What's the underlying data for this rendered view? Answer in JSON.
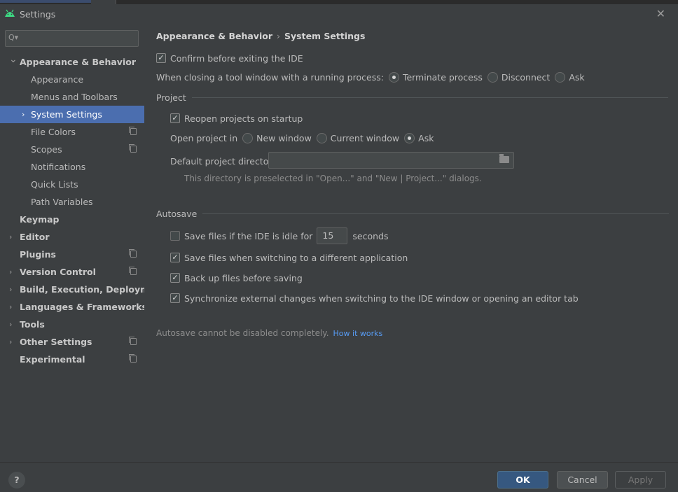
{
  "window": {
    "title": "Settings"
  },
  "search": {
    "placeholder": ""
  },
  "sidebar": {
    "items": [
      {
        "label": "Appearance & Behavior",
        "level": 0,
        "bold": true,
        "arrow": "chevron-down-icon",
        "project": false
      },
      {
        "label": "Appearance",
        "level": 1,
        "bold": false,
        "arrow": "",
        "project": false
      },
      {
        "label": "Menus and Toolbars",
        "level": 1,
        "bold": false,
        "arrow": "",
        "project": false
      },
      {
        "label": "System Settings",
        "level": 1,
        "bold": false,
        "arrow": "chevron-right-icon",
        "project": false,
        "selected": true
      },
      {
        "label": "File Colors",
        "level": 1,
        "bold": false,
        "arrow": "",
        "project": true
      },
      {
        "label": "Scopes",
        "level": 1,
        "bold": false,
        "arrow": "",
        "project": true
      },
      {
        "label": "Notifications",
        "level": 1,
        "bold": false,
        "arrow": "",
        "project": false
      },
      {
        "label": "Quick Lists",
        "level": 1,
        "bold": false,
        "arrow": "",
        "project": false
      },
      {
        "label": "Path Variables",
        "level": 1,
        "bold": false,
        "arrow": "",
        "project": false
      },
      {
        "label": "Keymap",
        "level": 0,
        "bold": true,
        "arrow": "",
        "project": false
      },
      {
        "label": "Editor",
        "level": 0,
        "bold": true,
        "arrow": "chevron-right-icon",
        "project": false
      },
      {
        "label": "Plugins",
        "level": 0,
        "bold": true,
        "arrow": "",
        "project": true
      },
      {
        "label": "Version Control",
        "level": 0,
        "bold": true,
        "arrow": "chevron-right-icon",
        "project": true
      },
      {
        "label": "Build, Execution, Deployment",
        "level": 0,
        "bold": true,
        "arrow": "chevron-right-icon",
        "project": false
      },
      {
        "label": "Languages & Frameworks",
        "level": 0,
        "bold": true,
        "arrow": "chevron-right-icon",
        "project": false
      },
      {
        "label": "Tools",
        "level": 0,
        "bold": true,
        "arrow": "chevron-right-icon",
        "project": false
      },
      {
        "label": "Other Settings",
        "level": 0,
        "bold": true,
        "arrow": "chevron-right-icon",
        "project": true
      },
      {
        "label": "Experimental",
        "level": 0,
        "bold": true,
        "arrow": "",
        "project": true
      }
    ]
  },
  "breadcrumb": {
    "parent": "Appearance & Behavior",
    "separator": "›",
    "current": "System Settings"
  },
  "general": {
    "confirm_exit": {
      "label": "Confirm before exiting the IDE",
      "checked": true
    },
    "closing_label": "When closing a tool window with a running process:",
    "closing_options": [
      {
        "label": "Terminate process",
        "selected": true
      },
      {
        "label": "Disconnect",
        "selected": false
      },
      {
        "label": "Ask",
        "selected": false
      }
    ]
  },
  "project": {
    "title": "Project",
    "reopen": {
      "label": "Reopen projects on startup",
      "checked": true
    },
    "open_in_label": "Open project in",
    "open_in_options": [
      {
        "label": "New window",
        "selected": false
      },
      {
        "label": "Current window",
        "selected": false
      },
      {
        "label": "Ask",
        "selected": true
      }
    ],
    "default_dir_label": "Default project directory:",
    "default_dir_value": "",
    "hint": "This directory is preselected in \"Open...\" and \"New | Project...\" dialogs."
  },
  "autosave": {
    "title": "Autosave",
    "idle": {
      "label_before": "Save files if the IDE is idle for",
      "value": "15",
      "label_after": "seconds",
      "checked": false
    },
    "switching": {
      "label": "Save files when switching to a different application",
      "checked": true
    },
    "backup": {
      "label": "Back up files before saving",
      "checked": true
    },
    "sync": {
      "label": "Synchronize external changes when switching to the IDE window or opening an editor tab",
      "checked": true
    },
    "note": "Autosave cannot be disabled completely.",
    "link": "How it works"
  },
  "footer": {
    "help": "?",
    "ok": "OK",
    "cancel": "Cancel",
    "apply": "Apply"
  },
  "colors": {
    "accent": "#4b6eaf",
    "ok_button": "#365880",
    "link": "#589df6",
    "background": "#3c3f41"
  }
}
